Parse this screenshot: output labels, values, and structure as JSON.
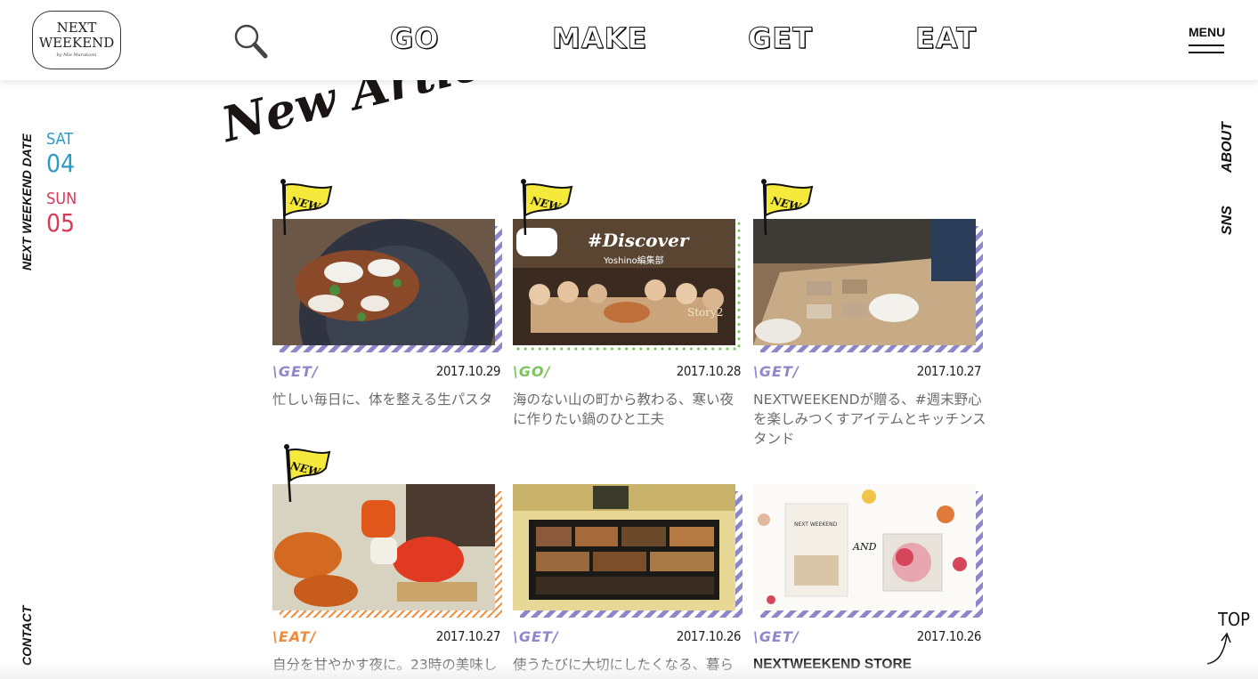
{
  "header": {
    "logo": {
      "line1": "NEXT",
      "line2": "WEEKEND",
      "byline": "by Mie Murakami"
    },
    "nav": [
      "GO",
      "MAKE",
      "GET",
      "EAT"
    ],
    "menu_label": "MENU"
  },
  "left_rail": {
    "date_label": "NEXT WEEKEND DATE",
    "sat_day": "SAT",
    "sat_num": "04",
    "sun_day": "SUN",
    "sun_num": "05",
    "contact": "CONTACT"
  },
  "right_rail": {
    "about": "ABOUT",
    "sns": "SNS",
    "top": "TOP"
  },
  "heading": "New Article",
  "flag_text": "NEW",
  "colors": {
    "get": "#8d86c9",
    "go": "#7cc35a",
    "eat": "#ef8a3a",
    "sat": "#2a9bc5",
    "sun": "#d83a5a",
    "flag": "#f5ea3b"
  },
  "articles": [
    {
      "category": "GET",
      "date": "2017.10.29",
      "title": "忙しい毎日に、体を整える生パスタ",
      "new": true
    },
    {
      "category": "GO",
      "date": "2017.10.28",
      "title": "海のない山の町から教わる、寒い夜に作りたい鍋のひと工夫",
      "new": true,
      "photo_text1": "#Discover",
      "photo_text2": "Yoshino編集部",
      "photo_text3": "Story2"
    },
    {
      "category": "GET",
      "date": "2017.10.27",
      "title": "NEXTWEEKENDが贈る、#週末野心を楽しみつくすアイテムとキッチンスタンド",
      "new": true
    },
    {
      "category": "EAT",
      "date": "2017.10.27",
      "title": "自分を甘やかす夜に。23時の美味し",
      "new": true
    },
    {
      "category": "GET",
      "date": "2017.10.26",
      "title": "使うたびに大切にしたくなる、暮ら",
      "new": false
    },
    {
      "category": "GET",
      "date": "2017.10.26",
      "title": "NEXTWEEKEND STORE",
      "new": false,
      "photo_text1": "NEXT WEEKEND",
      "photo_text2": "AND"
    }
  ]
}
